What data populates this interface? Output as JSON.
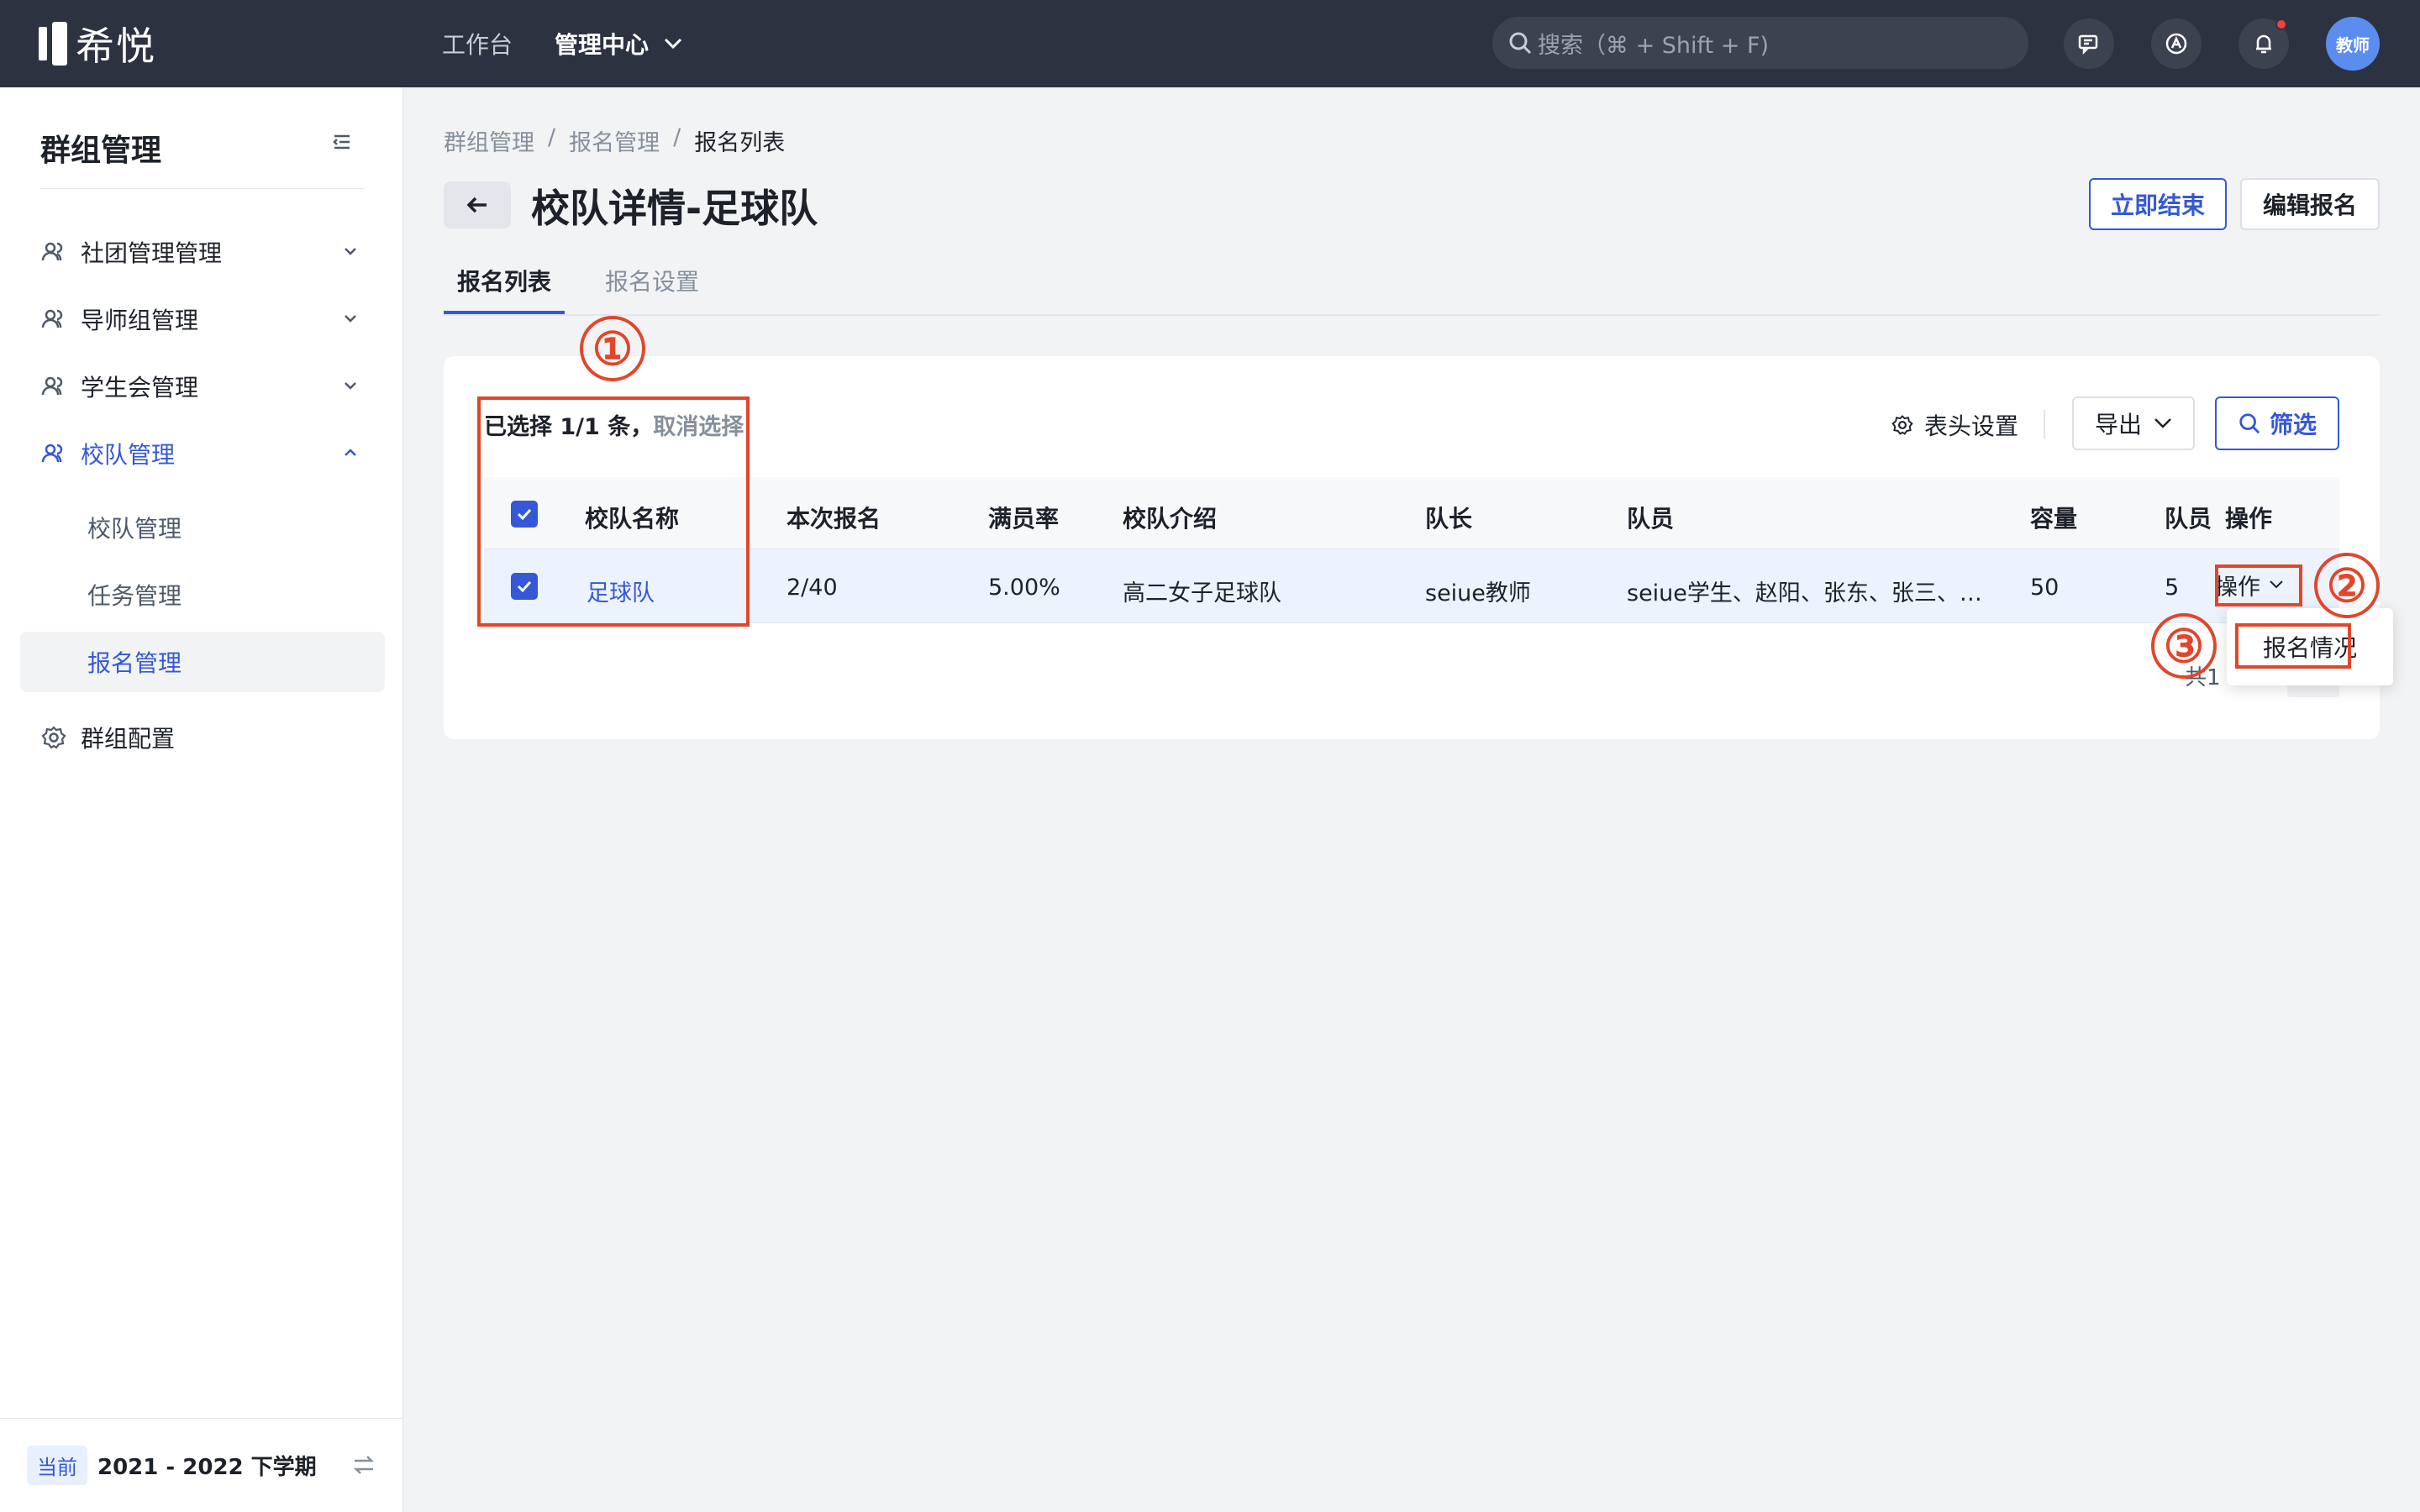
{
  "topbar": {
    "logo_text": "希悦",
    "nav": [
      {
        "label": "工作台"
      },
      {
        "label": "管理中心"
      }
    ],
    "search_placeholder": "搜索（⌘ + Shift + F)",
    "avatar_label": "教师"
  },
  "sidebar": {
    "title": "群组管理",
    "items": [
      {
        "label": "社团管理管理",
        "icon": "users-icon"
      },
      {
        "label": "导师组管理",
        "icon": "users-icon"
      },
      {
        "label": "学生会管理",
        "icon": "users-icon"
      },
      {
        "label": "校队管理",
        "icon": "users-icon"
      }
    ],
    "sub_items": [
      {
        "label": "校队管理"
      },
      {
        "label": "任务管理"
      },
      {
        "label": "报名管理"
      }
    ],
    "config": {
      "label": "群组配置",
      "icon": "gear-icon"
    },
    "footer": {
      "tag": "当前",
      "term": "2021 - 2022 下学期"
    }
  },
  "breadcrumb": [
    "群组管理",
    "报名管理",
    "报名列表"
  ],
  "page": {
    "title": "校队详情-足球队",
    "end_button": "立即结束",
    "edit_button": "编辑报名"
  },
  "tabs": [
    {
      "label": "报名列表",
      "active": true
    },
    {
      "label": "报名设置",
      "active": false
    }
  ],
  "toolbar": {
    "selection": "已选择 1/1 条，",
    "cancel_selection": "取消选择",
    "column_settings": "表头设置",
    "export": "导出",
    "filter": "筛选"
  },
  "table": {
    "columns": [
      "校队名称",
      "本次报名",
      "满员率",
      "校队介绍",
      "队长",
      "队员",
      "容量",
      "队员",
      "操作"
    ],
    "rows": [
      {
        "name": "足球队",
        "signup": "2/40",
        "fill_rate": "5.00%",
        "intro": "高二女子足球队",
        "captain": "seiue教师",
        "members": "seiue学生、赵阳、张东、张三、…",
        "capacity": "50",
        "member_count": "5",
        "action": "操作"
      }
    ]
  },
  "dropdown": {
    "item": "报名情况"
  },
  "pagination": {
    "text": "共1"
  },
  "annotations": [
    "①",
    "②",
    "③"
  ],
  "colors": {
    "accent": "#3458d6",
    "topbar": "#2d3240",
    "annotation": "#e1462b"
  }
}
